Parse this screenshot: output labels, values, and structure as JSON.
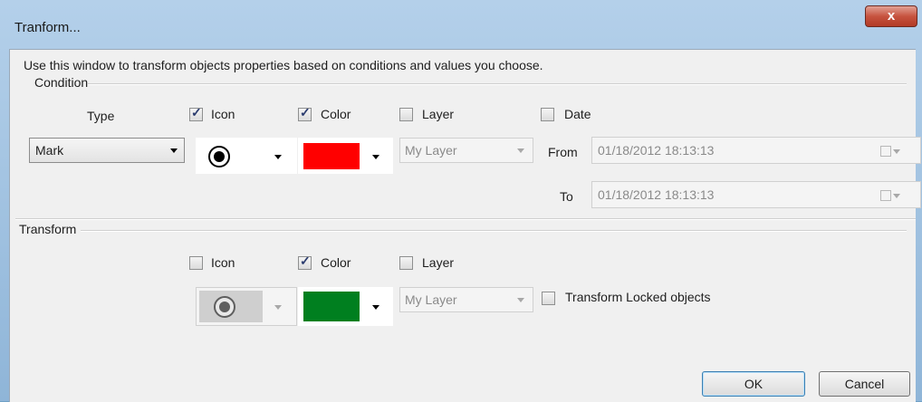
{
  "window": {
    "title": "Tranform...",
    "close_glyph": "x"
  },
  "description": "Use this window to transform objects properties based on conditions and values you choose.",
  "condition": {
    "group_label": "Condition",
    "type_label": "Type",
    "type_value": "Mark",
    "icon_label": "Icon",
    "icon_checked": true,
    "color_label": "Color",
    "color_checked": true,
    "color_value": "#ff0000",
    "layer_label": "Layer",
    "layer_checked": false,
    "layer_value": "My Layer",
    "date_label": "Date",
    "date_checked": false,
    "from_label": "From",
    "from_value": "01/18/2012 18:13:13",
    "to_label": "To",
    "to_value": "01/18/2012 18:13:13"
  },
  "transform": {
    "group_label": "Transform",
    "icon_label": "Icon",
    "icon_checked": false,
    "color_label": "Color",
    "color_checked": true,
    "color_value": "#007f1f",
    "layer_label": "Layer",
    "layer_checked": false,
    "layer_value": "My Layer",
    "locked_label": "Transform Locked objects",
    "locked_checked": false
  },
  "buttons": {
    "ok": "OK",
    "cancel": "Cancel"
  }
}
